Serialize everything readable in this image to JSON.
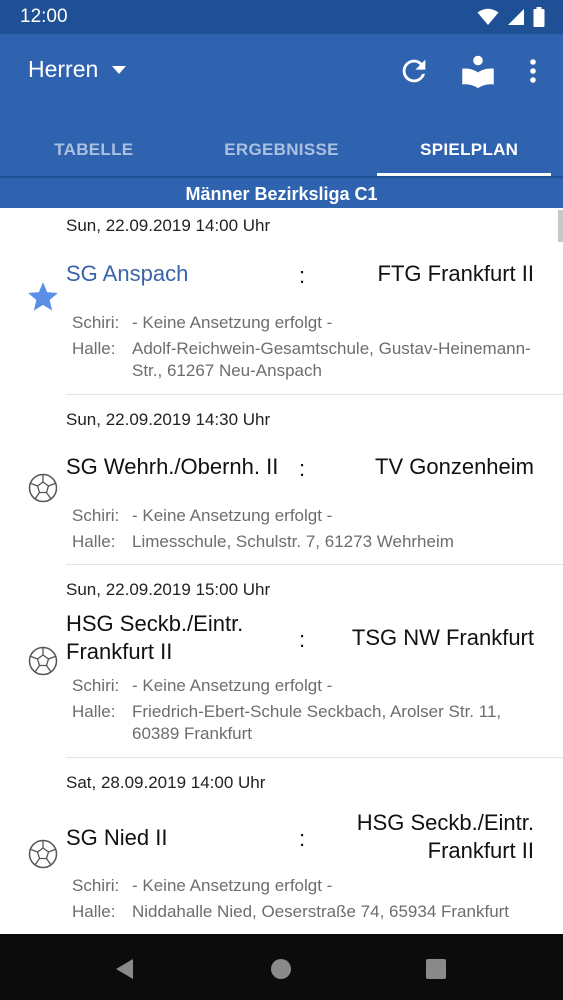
{
  "status_bar": {
    "time": "12:00"
  },
  "app_bar": {
    "title": "Herren",
    "actions": [
      "refresh-icon",
      "reader-icon",
      "more-vert-icon"
    ]
  },
  "tabs": [
    {
      "label": "TABELLE",
      "active": false
    },
    {
      "label": "ERGEBNISSE",
      "active": false
    },
    {
      "label": "SPIELPLAN",
      "active": true
    }
  ],
  "league": "Männer Bezirksliga C1",
  "labels": {
    "referee": "Schiri:",
    "hall": "Halle:"
  },
  "matches": [
    {
      "date": "Sun, 22.09.2019 14:00 Uhr",
      "home": "SG Anspach",
      "separator": ":",
      "away": "FTG Frankfurt II",
      "referee": "- Keine Ansetzung erfolgt -",
      "hall": "Adolf-Reichwein-Gesamtschule, Gustav-Heinemann-Str., 61267 Neu-Anspach",
      "icon": "star-icon",
      "favorite": true
    },
    {
      "date": "Sun, 22.09.2019 14:30 Uhr",
      "home": "SG Wehrh./Obernh. II",
      "separator": ":",
      "away": "TV Gonzenheim",
      "referee": "- Keine Ansetzung erfolgt -",
      "hall": "Limesschule, Schulstr. 7, 61273 Wehrheim",
      "icon": "ball-icon",
      "favorite": false
    },
    {
      "date": "Sun, 22.09.2019 15:00 Uhr",
      "home": "HSG Seckb./Eintr. Frankfurt II",
      "separator": ":",
      "away": "TSG NW Frankfurt",
      "referee": "- Keine Ansetzung erfolgt -",
      "hall": "Friedrich-Ebert-Schule Seckbach, Arolser Str. 11, 60389 Frankfurt",
      "icon": "ball-icon",
      "favorite": false
    },
    {
      "date": "Sat, 28.09.2019 14:00 Uhr",
      "home": "SG Nied II",
      "separator": ":",
      "away": "HSG Seckb./Eintr. Frankfurt II",
      "referee": "- Keine Ansetzung erfolgt -",
      "hall": "Niddahalle Nied, Oeserstraße 74, 65934 Frankfurt",
      "icon": "ball-icon",
      "favorite": false
    }
  ],
  "colors": {
    "status_bar": "#1f4f95",
    "primary": "#2f63b0",
    "favorite": "#3a64a8",
    "nav_bar": "#0c0c0c"
  }
}
